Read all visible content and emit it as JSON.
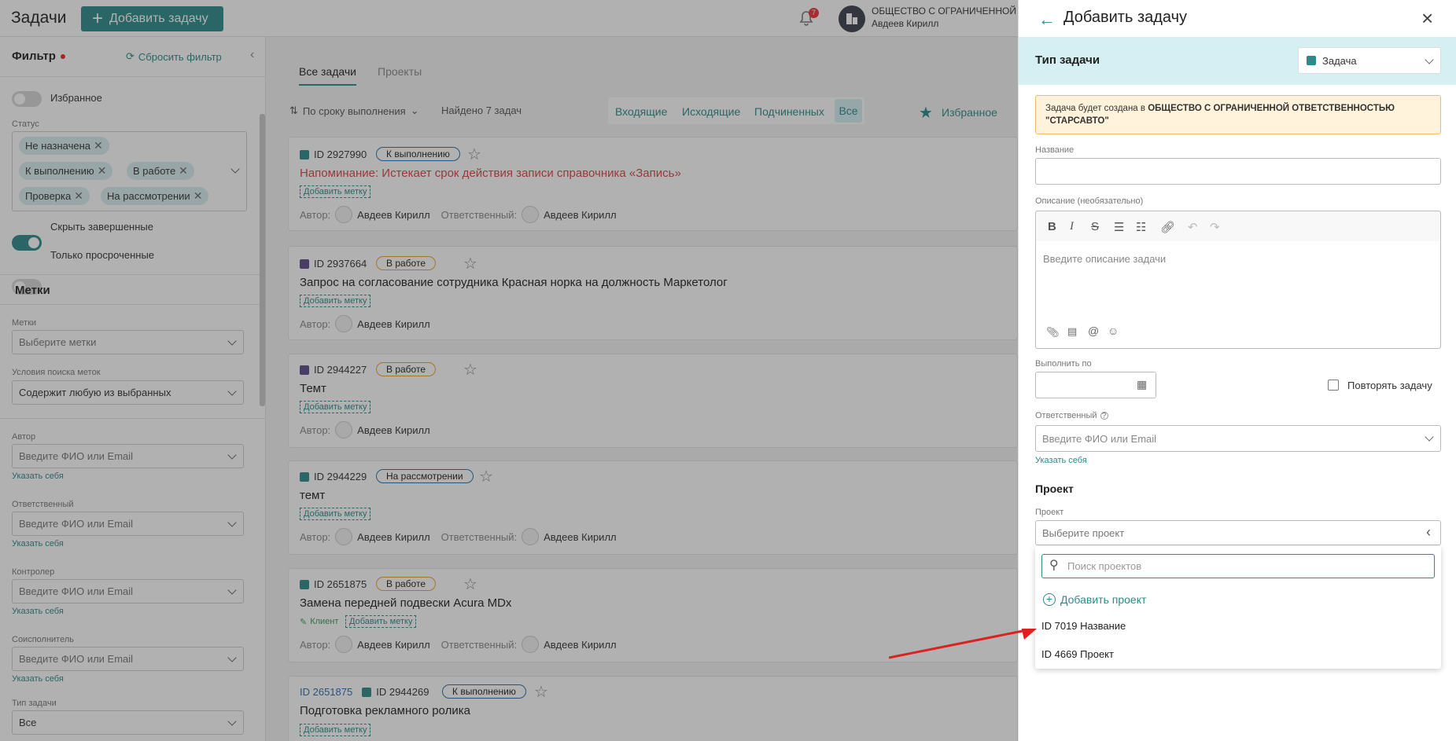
{
  "header": {
    "title": "Задачи",
    "add_task": "Добавить задачу",
    "notifications_count": "7",
    "org_name": "ОБЩЕСТВО С ОГРАНИЧЕННОЙ ОТВЕ",
    "user_name": "Авдеев Кирилл"
  },
  "filter": {
    "title": "Фильтр",
    "reset": "Сбросить фильтр",
    "favorites": "Избранное",
    "status_label": "Статус",
    "statuses": [
      "Не назначена",
      "К выполнению",
      "В работе",
      "Проверка",
      "На рассмотрении"
    ],
    "hide_completed": "Скрыть завершенные",
    "only_overdue": "Только просроченные",
    "marks_heading": "Метки",
    "marks_label": "Метки",
    "marks_placeholder": "Выберите метки",
    "mark_cond_label": "Условия поиска меток",
    "mark_cond_value": "Содержит любую из выбранных",
    "author_label": "Автор",
    "person_placeholder": "Введите ФИО или Email",
    "specify_self": "Указать себя",
    "responsible_label": "Ответственный",
    "controller_label": "Контролер",
    "coexec_label": "Соисполнитель",
    "task_type_label": "Тип задачи",
    "task_type_value": "Все"
  },
  "list": {
    "tabs": [
      "Все задачи",
      "Проекты"
    ],
    "sort": "По сроку выполнения",
    "found": "Найдено 7 задач",
    "filters": [
      "Входящие",
      "Исходящие",
      "Подчиненных",
      "Все"
    ],
    "favorites": "Избранное",
    "add_mark": "Добавить метку",
    "author": "Автор:",
    "responsible": "Ответственный:",
    "client_tag": "Клиент",
    "cards": [
      {
        "id": "ID 2927990",
        "status": "К выполнению",
        "title": "Напоминание: Истекает срок действия записи справочника «Запись»",
        "author": "Авдеев Кирилл",
        "resp": "Авдеев Кирилл"
      },
      {
        "id": "ID 2937664",
        "status": "В работе",
        "title": "Запрос на согласование сотрудника Красная норка на должность Маркетолог",
        "author": "Авдеев Кирилл"
      },
      {
        "id": "ID 2944227",
        "status": "В работе",
        "title": "Темт",
        "author": "Авдеев Кирилл"
      },
      {
        "id": "ID 2944229",
        "status": "На рассмотрении",
        "title": "темт",
        "author": "Авдеев Кирилл",
        "resp": "Авдеев Кирилл"
      },
      {
        "id": "ID 2651875",
        "status": "В работе",
        "title": "Замена передней подвески Acura MDx",
        "author": "Авдеев Кирилл",
        "resp": "Авдеев Кирилл"
      },
      {
        "parent": "ID 2651875",
        "id": "ID 2944269",
        "status": "К выполнению",
        "title": "Подготовка рекламного ролика"
      }
    ]
  },
  "panel": {
    "title": "Добавить задачу",
    "type_label": "Тип задачи",
    "type_value": "Задача",
    "notice_prefix": "Задача будет создана в ",
    "notice_org": "ОБЩЕСТВО С ОГРАНИЧЕННОЙ ОТВЕТСТВЕННОСТЬЮ \"СТАРСАВТО\"",
    "name_label": "Название",
    "desc_label": "Описание (необязательно)",
    "desc_placeholder": "Введите описание задачи",
    "due_label": "Выполнить по",
    "repeat": "Повторять задачу",
    "resp_label": "Ответственный",
    "resp_placeholder": "Введите ФИО или Email",
    "specify_self": "Указать себя",
    "project_heading": "Проект",
    "project_label": "Проект",
    "project_placeholder": "Выберите проект",
    "search_placeholder": "Поиск проектов",
    "add_project": "Добавить проект",
    "options": [
      "ID 7019 Название",
      "ID 4669 Проект"
    ]
  },
  "colors": {
    "accent": "#2d8a8a",
    "annotation_arrow": "#e02020",
    "notice_bg": "#fff3dc"
  }
}
